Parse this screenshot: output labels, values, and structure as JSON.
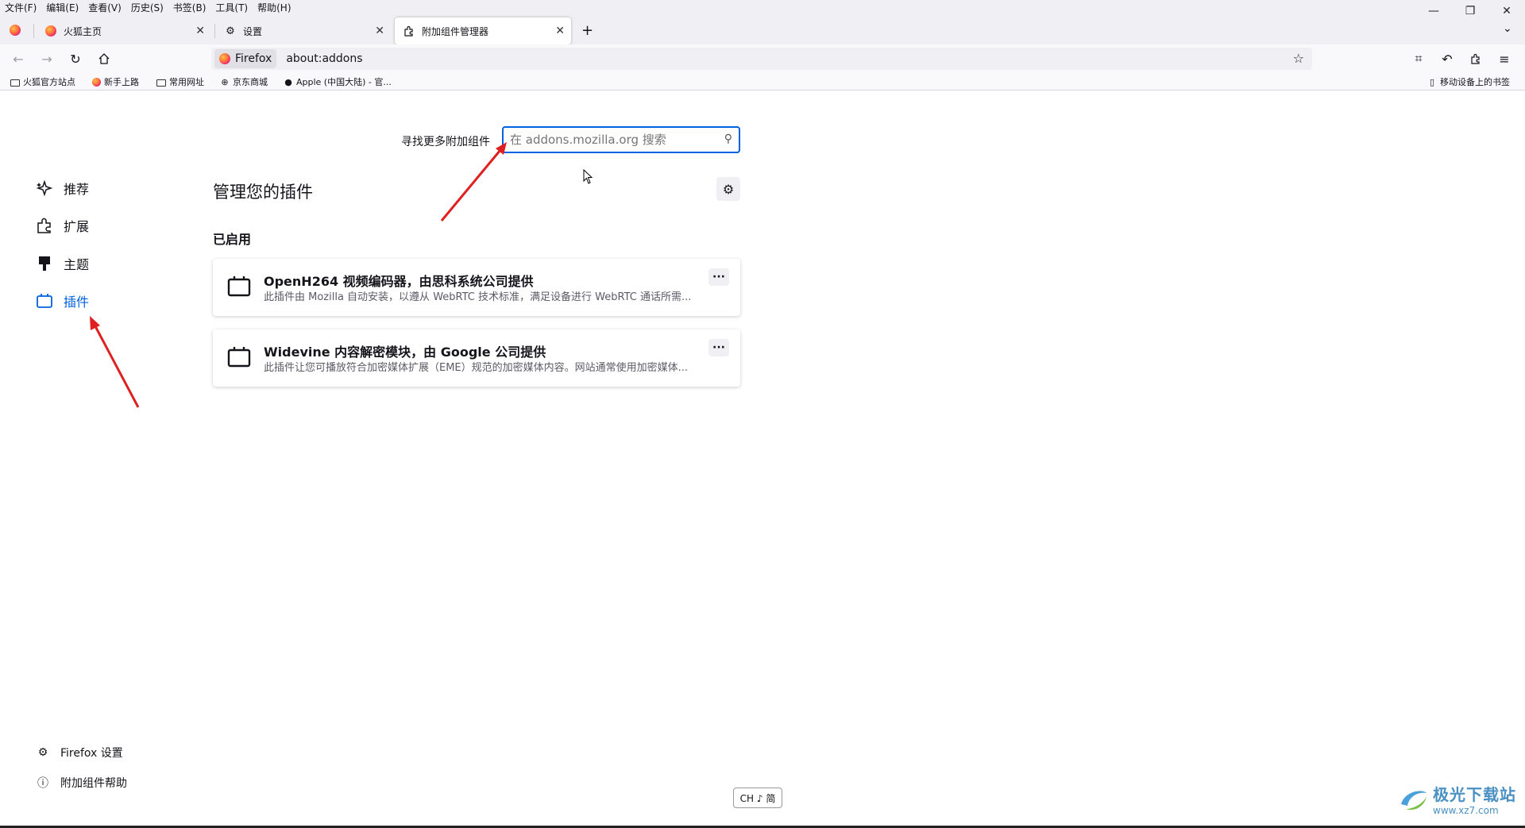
{
  "menubar": {
    "items": [
      "文件(F)",
      "编辑(E)",
      "查看(V)",
      "历史(S)",
      "书签(B)",
      "工具(T)",
      "帮助(H)"
    ]
  },
  "tabs": [
    {
      "title": "火狐主页",
      "icon": "firefox-icon",
      "active": false
    },
    {
      "title": "设置",
      "icon": "gear-icon",
      "active": false
    },
    {
      "title": "附加组件管理器",
      "icon": "puzzle-icon",
      "active": true
    }
  ],
  "navbar": {
    "identity": "Firefox",
    "url": "about:addons"
  },
  "bookmarks": {
    "items": [
      {
        "label": "火狐官方站点",
        "icon": "folder-icon"
      },
      {
        "label": "新手上路",
        "icon": "firefox-icon"
      },
      {
        "label": "常用网址",
        "icon": "folder-icon"
      },
      {
        "label": "京东商城",
        "icon": "globe-icon"
      },
      {
        "label": "Apple (中国大陆) - 官...",
        "icon": "apple-icon"
      }
    ],
    "mobile": "移动设备上的书签"
  },
  "search": {
    "label": "寻找更多附加组件",
    "placeholder": "在 addons.mozilla.org 搜索"
  },
  "categories": [
    {
      "label": "推荐",
      "icon": "sparkle-icon",
      "selected": false
    },
    {
      "label": "扩展",
      "icon": "puzzle-icon",
      "selected": false
    },
    {
      "label": "主题",
      "icon": "brush-icon",
      "selected": false
    },
    {
      "label": "插件",
      "icon": "plugin-icon",
      "selected": true
    }
  ],
  "main": {
    "title": "管理您的插件",
    "section": "已启用",
    "plugins": [
      {
        "name": "OpenH264 视频编码器，由思科系统公司提供",
        "description": "此插件由 Mozilla 自动安装，以遵从 WebRTC 技术标准，满足设备进行 WebRTC 通话所需..."
      },
      {
        "name": "Widevine 内容解密模块，由 Google 公司提供",
        "description": "此插件让您可播放符合加密媒体扩展（EME）规范的加密媒体内容。网站通常使用加密媒体..."
      }
    ]
  },
  "footer": {
    "settings": "Firefox 设置",
    "help": "附加组件帮助"
  },
  "ime": "CH ♪ 简",
  "watermark": {
    "name": "极光下载站",
    "url": "www.xz7.com"
  },
  "colors": {
    "accent": "#0061e0",
    "annotation_arrow": "#e02020"
  }
}
